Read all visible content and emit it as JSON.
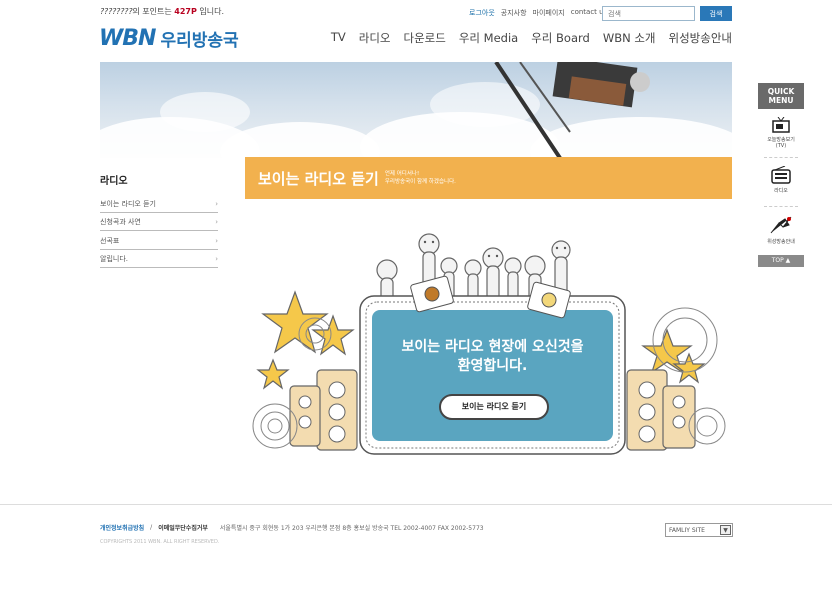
{
  "header": {
    "user": "????????",
    "points_prefix": "의 포인트는 ",
    "points": "427P",
    "points_suffix": " 입니다.",
    "links": [
      "로그아웃",
      "공지사항",
      "마이페이지",
      "contact us"
    ],
    "search_placeholder": "검색",
    "search_button": "검색",
    "logo_en": "WBN",
    "logo_ko": "우리방송국",
    "nav": [
      "TV",
      "라디오",
      "다운로드",
      "우리 Media",
      "우리 Board",
      "WBN 소개",
      "위성방송안내"
    ]
  },
  "sidebar": {
    "title": "라디오",
    "items": [
      "보이는 라디오 듣기",
      "신청곡과 사연",
      "선곡표",
      "알립니다."
    ]
  },
  "banner": {
    "title": "보이는 라디오 듣기",
    "sub1": "언제 어디서나!",
    "sub2": "우리방송국이 함께 하겠습니다."
  },
  "stage": {
    "welcome1": "보이는 라디오 현장에 오신것을",
    "welcome2": "환영합니다.",
    "button": "보이는 라디오 듣기"
  },
  "quick": {
    "header1": "QUICK",
    "header2": "MENU",
    "items": [
      {
        "label1": "오늘방송보기",
        "label2": "(TV)",
        "icon": "tv-icon"
      },
      {
        "label1": "라디오",
        "label2": "",
        "icon": "radio-icon"
      },
      {
        "label1": "위성방송안내",
        "label2": "",
        "icon": "satellite-icon"
      }
    ],
    "top": "TOP ▲"
  },
  "footer": {
    "privacy": "개인정보취급방침",
    "sep": "/",
    "email": "이메일무단수집거부",
    "address": "서울특별시 중구 회현동 1가 203 우리은행 본점 8층 홍보실 방송국   TEL 2002-4007  FAX 2002-5773",
    "copyright": "COPYRIGHTS 2011 WBN. ALL RIGHT RESERVED.",
    "family": "FAMLIY SITE"
  },
  "colors": {
    "accent": "#2272b3",
    "banner": "#f2b14e",
    "screen": "#5aa5c0"
  }
}
